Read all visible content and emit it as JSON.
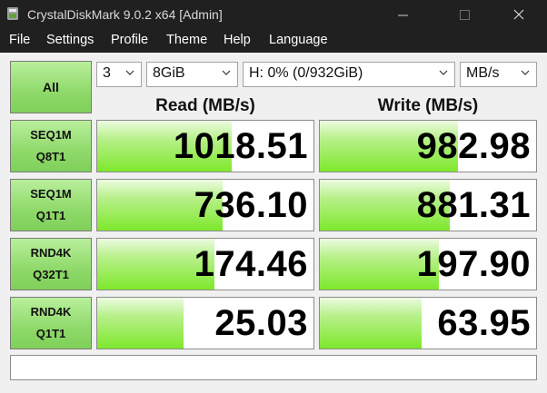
{
  "window": {
    "title": "CrystalDiskMark 9.0.2 x64 [Admin]",
    "controls": {
      "minimize": "─",
      "maximize": "☐",
      "close": "✕"
    }
  },
  "menu": [
    "File",
    "Settings",
    "Profile",
    "Theme",
    "Help",
    "Language"
  ],
  "controls": {
    "all_button": "All",
    "count": "3",
    "size": "8GiB",
    "drive": "H: 0% (0/932GiB)",
    "unit": "MB/s"
  },
  "headers": {
    "read": "Read (MB/s)",
    "write": "Write (MB/s)"
  },
  "tests": [
    {
      "line1": "SEQ1M",
      "line2": "Q8T1",
      "read": "1018.51",
      "write": "982.98",
      "read_level": 0.62,
      "write_level": 0.64
    },
    {
      "line1": "SEQ1M",
      "line2": "Q1T1",
      "read": "736.10",
      "write": "881.31",
      "read_level": 0.58,
      "write_level": 0.6
    },
    {
      "line1": "RND4K",
      "line2": "Q32T1",
      "read": "174.46",
      "write": "197.90",
      "read_level": 0.54,
      "write_level": 0.55
    },
    {
      "line1": "RND4K",
      "line2": "Q1T1",
      "read": "25.03",
      "write": "63.95",
      "read_level": 0.4,
      "write_level": 0.47
    }
  ],
  "status_text": "",
  "colors": {
    "titlebar": "#202020",
    "button_green": "#8fd96a",
    "bar_green": "#7ee82c"
  }
}
